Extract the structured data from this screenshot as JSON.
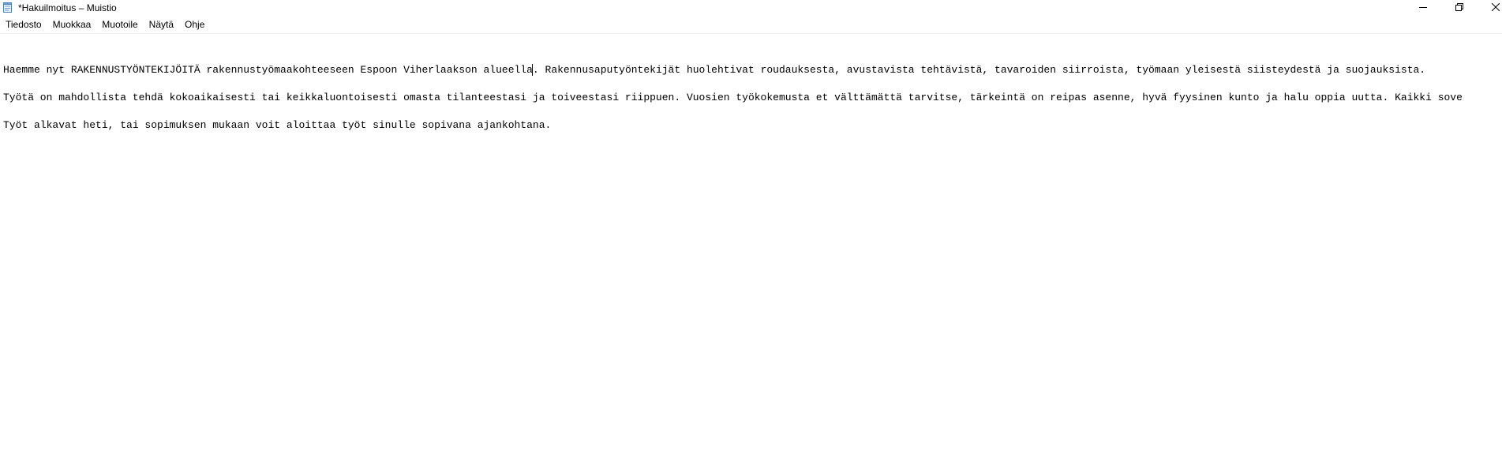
{
  "window": {
    "title": "*Hakuilmoitus – Muistio",
    "app_icon": "notepad-icon",
    "controls": {
      "minimize_icon": "minimize-icon",
      "maximize_icon": "restore-icon",
      "close_icon": "close-icon"
    }
  },
  "menu": {
    "items": [
      {
        "label": "Tiedosto"
      },
      {
        "label": "Muokkaa"
      },
      {
        "label": "Muotoile"
      },
      {
        "label": "Näytä"
      },
      {
        "label": "Ohje"
      }
    ]
  },
  "editor": {
    "line1_before_caret": "Haemme nyt RAKENNUSTYÖNTEKIJÖITÄ rakennustyömaakohteeseen Espoon Viherlaakson alueella",
    "line1_after_caret": ". Rakennusaputyöntekijät huolehtivat roudauksesta, avustavista tehtävistä, tavaroiden siirroista, työmaan yleisestä siisteydestä ja suojauksista.",
    "line2": "Työtä on mahdollista tehdä kokoaikaisesti tai keikkaluontoisesti omasta tilanteestasi ja toiveestasi riippuen. Vuosien työkokemusta et välttämättä tarvitse, tärkeintä on reipas asenne, hyvä fyysinen kunto ja halu oppia uutta. Kaikki sove",
    "line3": "Työt alkavat heti, tai sopimuksen mukaan voit aloittaa työt sinulle sopivana ajankohtana."
  }
}
